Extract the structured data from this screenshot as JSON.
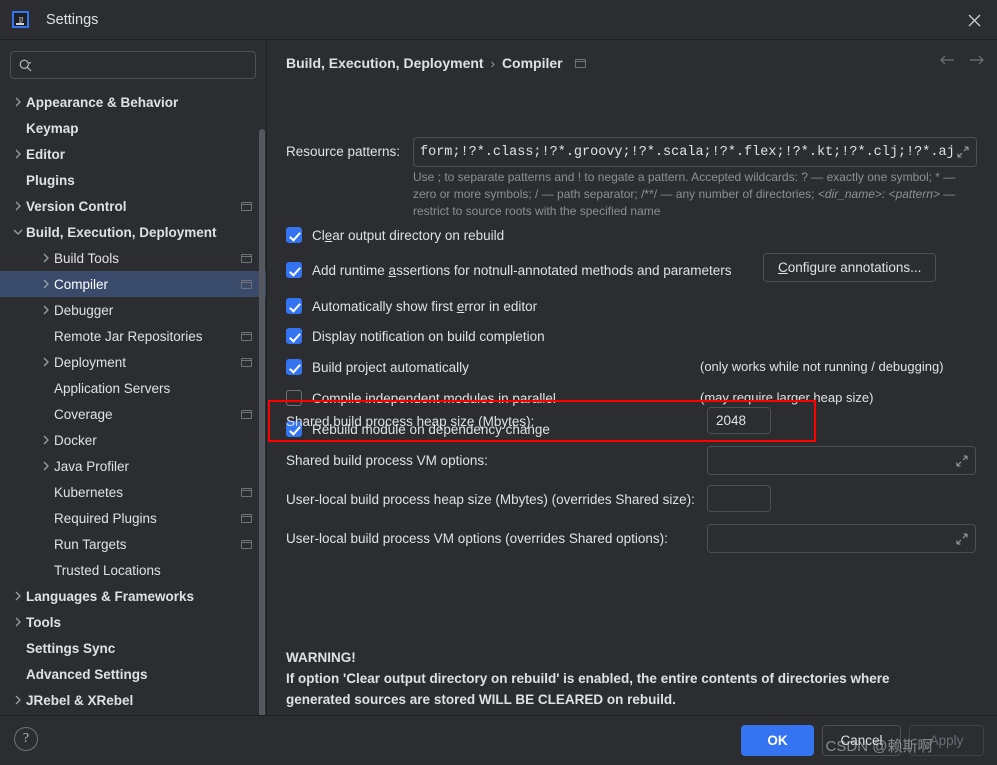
{
  "window": {
    "title": "Settings",
    "logo_icon": "intellij-idea-logo",
    "close_icon": "close-icon"
  },
  "sidebar": {
    "search": {
      "placeholder": "",
      "value": "",
      "icon": "search-icon"
    },
    "items": [
      {
        "label": "Appearance & Behavior",
        "indent": 0,
        "arrow": "right",
        "bold": true,
        "badge": false,
        "selected": false
      },
      {
        "label": "Keymap",
        "indent": 0,
        "arrow": "none",
        "bold": true,
        "badge": false,
        "selected": false
      },
      {
        "label": "Editor",
        "indent": 0,
        "arrow": "right",
        "bold": true,
        "badge": false,
        "selected": false
      },
      {
        "label": "Plugins",
        "indent": 0,
        "arrow": "none",
        "bold": true,
        "badge": false,
        "selected": false
      },
      {
        "label": "Version Control",
        "indent": 0,
        "arrow": "right",
        "bold": true,
        "badge": true,
        "selected": false
      },
      {
        "label": "Build, Execution, Deployment",
        "indent": 0,
        "arrow": "down",
        "bold": true,
        "badge": false,
        "selected": false
      },
      {
        "label": "Build Tools",
        "indent": 1,
        "arrow": "right",
        "bold": false,
        "badge": true,
        "selected": false
      },
      {
        "label": "Compiler",
        "indent": 1,
        "arrow": "right",
        "bold": false,
        "badge": true,
        "selected": true
      },
      {
        "label": "Debugger",
        "indent": 1,
        "arrow": "right",
        "bold": false,
        "badge": false,
        "selected": false
      },
      {
        "label": "Remote Jar Repositories",
        "indent": 1,
        "arrow": "none",
        "bold": false,
        "badge": true,
        "selected": false
      },
      {
        "label": "Deployment",
        "indent": 1,
        "arrow": "right",
        "bold": false,
        "badge": true,
        "selected": false
      },
      {
        "label": "Application Servers",
        "indent": 1,
        "arrow": "none",
        "bold": false,
        "badge": false,
        "selected": false
      },
      {
        "label": "Coverage",
        "indent": 1,
        "arrow": "none",
        "bold": false,
        "badge": true,
        "selected": false
      },
      {
        "label": "Docker",
        "indent": 1,
        "arrow": "right",
        "bold": false,
        "badge": false,
        "selected": false
      },
      {
        "label": "Java Profiler",
        "indent": 1,
        "arrow": "right",
        "bold": false,
        "badge": false,
        "selected": false
      },
      {
        "label": "Kubernetes",
        "indent": 1,
        "arrow": "none",
        "bold": false,
        "badge": true,
        "selected": false
      },
      {
        "label": "Required Plugins",
        "indent": 1,
        "arrow": "none",
        "bold": false,
        "badge": true,
        "selected": false
      },
      {
        "label": "Run Targets",
        "indent": 1,
        "arrow": "none",
        "bold": false,
        "badge": true,
        "selected": false
      },
      {
        "label": "Trusted Locations",
        "indent": 1,
        "arrow": "none",
        "bold": false,
        "badge": false,
        "selected": false
      },
      {
        "label": "Languages & Frameworks",
        "indent": 0,
        "arrow": "right",
        "bold": true,
        "badge": false,
        "selected": false
      },
      {
        "label": "Tools",
        "indent": 0,
        "arrow": "right",
        "bold": true,
        "badge": false,
        "selected": false
      },
      {
        "label": "Settings Sync",
        "indent": 0,
        "arrow": "none",
        "bold": true,
        "badge": false,
        "selected": false
      },
      {
        "label": "Advanced Settings",
        "indent": 0,
        "arrow": "none",
        "bold": true,
        "badge": false,
        "selected": false
      },
      {
        "label": "JRebel & XRebel",
        "indent": 0,
        "arrow": "right",
        "bold": true,
        "badge": false,
        "selected": false
      }
    ]
  },
  "content": {
    "breadcrumb": {
      "parent": "Build, Execution, Deployment",
      "separator": "›",
      "current": "Compiler"
    },
    "nav": {
      "back_icon": "arrow-left-icon",
      "forward_icon": "arrow-right-icon"
    },
    "resource_patterns": {
      "label": "Resource patterns:",
      "value": "form;!?*.class;!?*.groovy;!?*.scala;!?*.flex;!?*.kt;!?*.clj;!?*.aj",
      "expand_icon": "expand-icon",
      "hint_line1": "Use ; to separate patterns and ! to negate a pattern. Accepted wildcards: ? — exactly one symbol; * — zero",
      "hint_line2_a": "or more symbols; / — path separator; /**/ — any number of directories; ",
      "hint_line2_b": "<dir_name>: <pattern>",
      "hint_line2_c": " — restrict",
      "hint_line3": "to source roots with the specified name"
    },
    "checkboxes": [
      {
        "label_pre": "Cl",
        "label_key": "e",
        "label_post": "ar output directory on rebuild",
        "checked": true,
        "note": ""
      },
      {
        "label_pre": "Add runtime ",
        "label_key": "a",
        "label_post": "ssertions for notnull-annotated methods and parameters",
        "checked": true,
        "note": ""
      },
      {
        "label_pre": "Automatically show first ",
        "label_key": "e",
        "label_post": "rror in editor",
        "checked": true,
        "note": ""
      },
      {
        "label_pre": "Display notification on build completion",
        "label_key": "",
        "label_post": "",
        "checked": true,
        "note": ""
      },
      {
        "label_pre": "Build project automatically",
        "label_key": "",
        "label_post": "",
        "checked": true,
        "note": "(only works while not running / debugging)"
      },
      {
        "label_pre": "Compile independent modules in parallel",
        "label_key": "",
        "label_post": "",
        "checked": false,
        "note": "(may require larger heap size)"
      },
      {
        "label_pre": "Rebuild module on dependency change",
        "label_key": "",
        "label_post": "",
        "checked": true,
        "note": ""
      }
    ],
    "configure_annotations": {
      "pre": "C",
      "key": "C",
      "label_post": "onfigure annotations..."
    },
    "fields": [
      {
        "label": "Shared build process heap size (Mbytes):",
        "value": "2048",
        "kind": "small",
        "highlighted": true
      },
      {
        "label": "Shared build process VM options:",
        "value": "",
        "kind": "wide",
        "highlighted": false
      },
      {
        "label": "User-local build process heap size (Mbytes) (overrides Shared size):",
        "value": "",
        "kind": "small",
        "highlighted": false
      },
      {
        "label": "User-local build process VM options (overrides Shared options):",
        "value": "",
        "kind": "wide",
        "highlighted": false
      }
    ],
    "warning": {
      "title": "WARNING!",
      "line1": "If option 'Clear output directory on rebuild' is enabled, the entire contents of directories where",
      "line2": "generated sources are stored WILL BE CLEARED on rebuild."
    }
  },
  "footer": {
    "help_icon": "help-icon",
    "help_label": "?",
    "ok_label": "OK",
    "cancel_label": "Cancel",
    "apply_label": "Apply"
  },
  "watermark": {
    "text": "CSDN @赖斯啊"
  },
  "colors": {
    "background": "#2b2d30",
    "accent": "#3574f0",
    "selection": "#3a4a6b",
    "border": "#4b4f56",
    "text": "#dfe1e5",
    "muted": "#8c9096",
    "highlight": "#ff0000"
  }
}
